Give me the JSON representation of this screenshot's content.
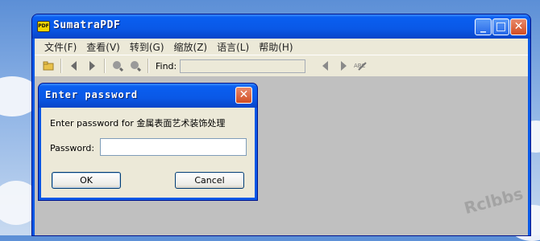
{
  "window": {
    "title": "SumatraPDF",
    "app_icon_text": "PDF",
    "controls": {
      "minimize": "_",
      "maximize": "□",
      "close": "✕"
    }
  },
  "menubar": {
    "items": [
      "文件(F)",
      "查看(V)",
      "转到(G)",
      "缩放(Z)",
      "语言(L)",
      "帮助(H)"
    ]
  },
  "toolbar": {
    "find_label": "Find:",
    "find_value": "",
    "icons": [
      "open-icon",
      "prev-page-icon",
      "next-page-icon",
      "zoom-in-icon",
      "zoom-out-icon",
      "find-prev-icon",
      "find-next-icon",
      "match-case-icon"
    ]
  },
  "dialog": {
    "title": "Enter password",
    "message": "Enter password for 金属表面艺术装饰处理",
    "password_label": "Password:",
    "password_value": "",
    "ok_label": "OK",
    "cancel_label": "Cancel",
    "close_glyph": "✕"
  },
  "watermark": "Rclbbs",
  "colors": {
    "titlebar": "#0a58e6",
    "client_bg": "#ece9d8",
    "canvas_bg": "#c0c0c0",
    "close_red": "#d14d22"
  }
}
